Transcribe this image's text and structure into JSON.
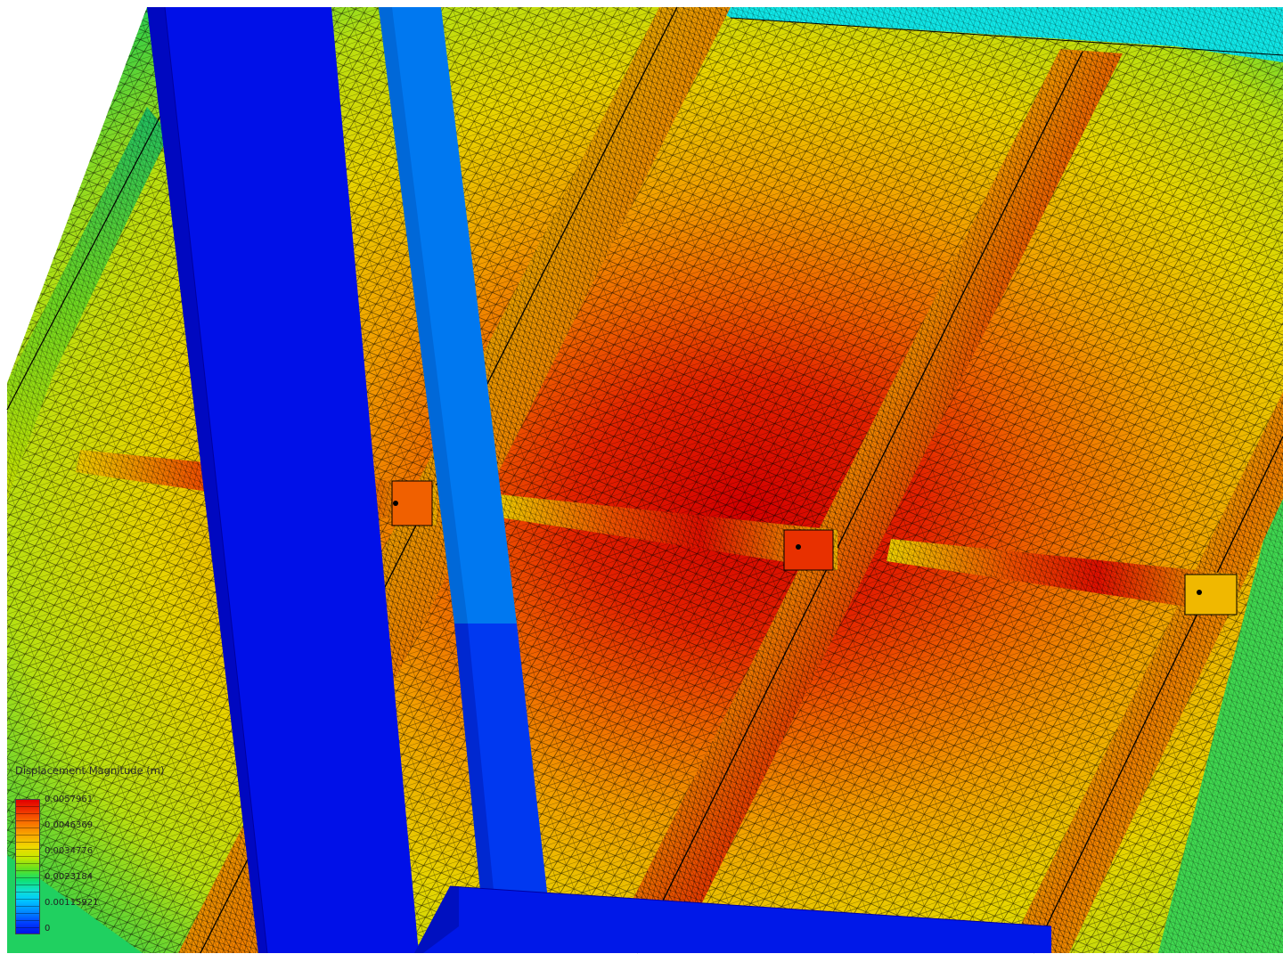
{
  "legend": {
    "title": "Displacement Magnitude (m)",
    "ticks": [
      "0.0057961",
      "0.0046369",
      "0.0034776",
      "0.0023184",
      "0.00115921",
      "0"
    ]
  },
  "colors": {
    "min_blue": "#0010e8",
    "mid_green": "#20d040",
    "mid_yellow": "#e8e000",
    "max_red": "#e10000",
    "mesh_lines": "#000000"
  }
}
